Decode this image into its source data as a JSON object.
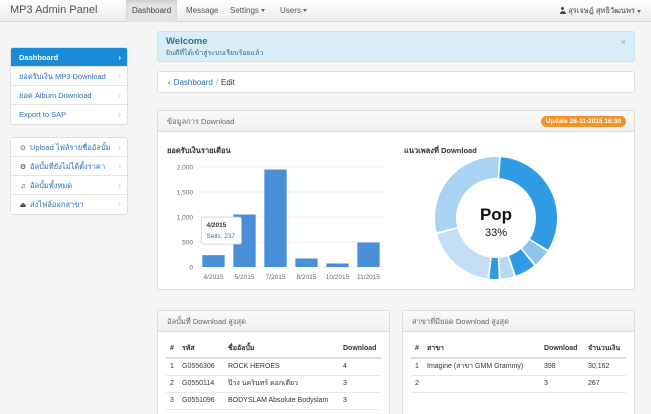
{
  "navbar": {
    "brand": "MP3 Admin Panel",
    "items": [
      {
        "label": "Dashboard"
      },
      {
        "label": "Message"
      },
      {
        "label": "Settings"
      },
      {
        "label": "Users"
      }
    ],
    "user": "สุรเจษฎ์ สุทธิวัฒนพร"
  },
  "sidebar": {
    "group1": [
      {
        "label": "Dashboard"
      },
      {
        "label": "ยอดรับเงิน MP3 Download"
      },
      {
        "label": "ยอด Album Download"
      },
      {
        "label": "Export to SAP"
      }
    ],
    "group2": [
      {
        "label": "Upload ไฟล์รายชื่ออัลบั้ม",
        "icon": "upload-icon"
      },
      {
        "label": "อัลบั้มที่ยังไม่ได้ตั้งราคา",
        "icon": "tag-icon"
      },
      {
        "label": "อัลบั้มทั้งหมด",
        "icon": "music-icon"
      },
      {
        "label": "ส่งไฟล์ออกสาขา",
        "icon": "send-icon"
      }
    ]
  },
  "alert": {
    "title": "Welcome",
    "message": "ยินดีที่ได้เข้าสู่ระบบเรียบร้อยแล้ว"
  },
  "breadcrumb": {
    "parent": "Dashboard",
    "current": "Edit"
  },
  "download_panel": {
    "heading": "ข้อมูลการ Download",
    "update_badge": "Update 28-11-2015 16:30"
  },
  "tooltip": {
    "category": "4/2015",
    "label": "Sells: 237"
  },
  "chart_data": [
    {
      "type": "bar",
      "title": "ยอดรับเงินรายเดือน",
      "categories": [
        "4/2015",
        "5/2015",
        "7/2015",
        "8/2015",
        "10/2015",
        "11/2015"
      ],
      "values": [
        237,
        1050,
        1950,
        170,
        70,
        490
      ],
      "ylim": [
        0,
        2000
      ],
      "yticks": [
        "0",
        "500",
        "1,000",
        "1,500",
        "2,000"
      ],
      "grid": true,
      "bar_color": "#4a90d9"
    },
    {
      "type": "pie",
      "title": "แนวเพลงที่ Download",
      "center_label": "Pop",
      "center_value": "33%",
      "slices": [
        {
          "value": 33,
          "color": "#2f9be5"
        },
        {
          "value": 5,
          "color": "#8ec3ee"
        },
        {
          "value": 6,
          "color": "#2f9be5"
        },
        {
          "value": 4,
          "color": "#b7d8f4"
        },
        {
          "value": 3,
          "color": "#2f9be5"
        },
        {
          "value": 19,
          "color": "#c5def5"
        },
        {
          "value": 30,
          "color": "#a9d2f3"
        }
      ]
    }
  ],
  "albums_panel": {
    "heading": "อัลบั้มที่ Download สูงสุด",
    "columns": [
      "#",
      "รหัส",
      "ชื่ออัลบั้ม",
      "Download"
    ],
    "rows": [
      [
        "1",
        "G0556306",
        "ROCK HEROES",
        "4"
      ],
      [
        "2",
        "G0550114",
        "ป๊าง นครินทร์ ดอกเดียว",
        "3"
      ],
      [
        "3",
        "G0551096",
        "BODYSLAM Absolute Bodyslam",
        "3"
      ]
    ]
  },
  "branches_panel": {
    "heading": "สาขาที่มียอด Download สูงสุด",
    "columns": [
      "#",
      "สาขา",
      "Download",
      "จำนวนเงิน"
    ],
    "rows": [
      [
        "1",
        "Imagine (สาขา GMM Grammy)",
        "398",
        "30,162"
      ],
      [
        "2",
        "",
        "3",
        "267"
      ]
    ]
  }
}
